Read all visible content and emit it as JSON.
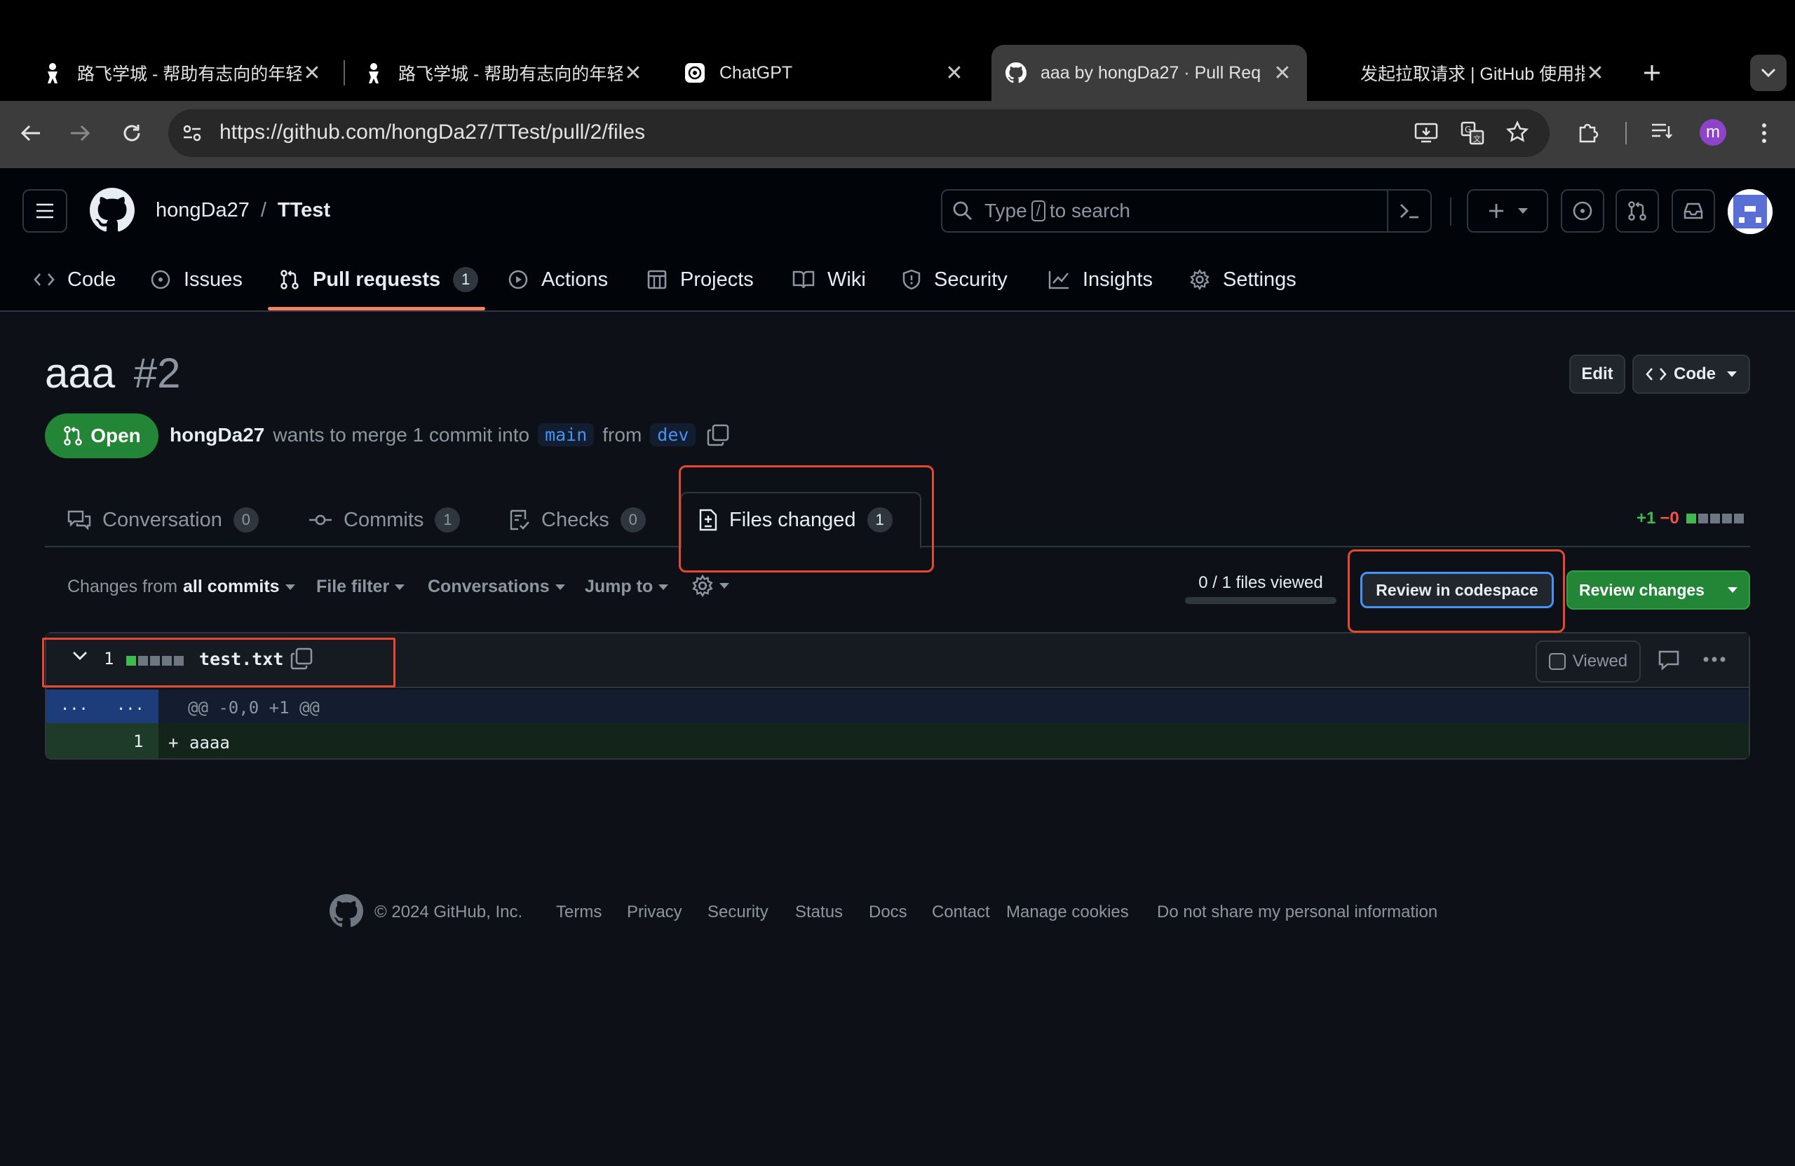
{
  "browser": {
    "tabs": [
      {
        "title": "路飞学城 - 帮助有志向的年轻",
        "active": false
      },
      {
        "title": "路飞学城 - 帮助有志向的年轻",
        "active": false
      },
      {
        "title": "ChatGPT",
        "active": false
      },
      {
        "title": "aaa by hongDa27 · Pull Req",
        "active": true
      },
      {
        "title": "发起拉取请求 | GitHub 使用指",
        "active": false
      }
    ],
    "url": "https://github.com/hongDa27/TTest/pull/2/files",
    "profile_initial": "m"
  },
  "header": {
    "owner": "hongDa27",
    "separator": "/",
    "repo": "TTest",
    "search_placeholder_prefix": "Type",
    "search_key": "/",
    "search_placeholder_suffix": "to search"
  },
  "repo_nav": {
    "code": "Code",
    "issues": "Issues",
    "pull_requests": "Pull requests",
    "pull_requests_count": "1",
    "actions": "Actions",
    "projects": "Projects",
    "wiki": "Wiki",
    "security": "Security",
    "insights": "Insights",
    "settings": "Settings"
  },
  "pr": {
    "title": "aaa",
    "number": "#2",
    "edit_label": "Edit",
    "code_label": "Code",
    "state": "Open",
    "author": "hongDa27",
    "merge_text": "wants to merge 1 commit into",
    "base_branch": "main",
    "from_text": "from",
    "head_branch": "dev"
  },
  "pr_tabs": {
    "conversation": "Conversation",
    "conversation_count": "0",
    "commits": "Commits",
    "commits_count": "1",
    "checks": "Checks",
    "checks_count": "0",
    "files_changed": "Files changed",
    "files_changed_count": "1",
    "additions": "+1",
    "deletions": "−0"
  },
  "toolbar": {
    "changes_from_prefix": "Changes from",
    "changes_from_value": "all commits",
    "file_filter": "File filter",
    "conversations": "Conversations",
    "jump_to": "Jump to",
    "files_viewed": "0 / 1 files viewed",
    "files_viewed_progress": 0,
    "review_codespace": "Review in codespace",
    "review_changes": "Review changes"
  },
  "diff": {
    "change_count": "1",
    "filename": "test.txt",
    "viewed_label": "Viewed",
    "hunk_gutter_left": "...",
    "hunk_gutter_right": "...",
    "hunk_header": "@@ -0,0 +1 @@",
    "line_number": "1",
    "line_marker": "+",
    "line_content": "aaaa"
  },
  "footer": {
    "copyright": "© 2024 GitHub, Inc.",
    "links": [
      "Terms",
      "Privacy",
      "Security",
      "Status",
      "Docs",
      "Contact",
      "Manage cookies",
      "Do not share my personal information"
    ]
  },
  "colors": {
    "background": "#0d1117",
    "open_green": "#238636",
    "highlight_red": "#e5482f",
    "accent_blue": "#4493f8"
  }
}
